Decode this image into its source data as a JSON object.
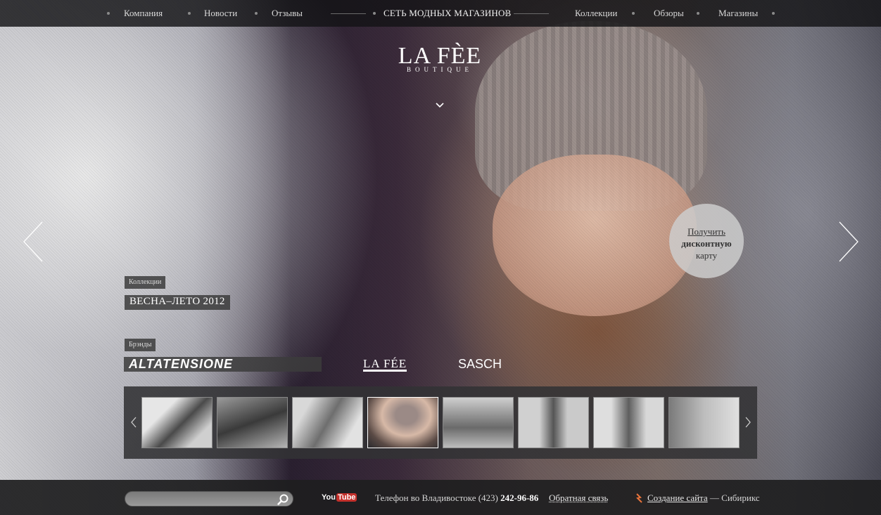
{
  "nav": {
    "left": [
      "Компания",
      "Новости",
      "Отзывы"
    ],
    "center": "СЕТЬ МОДНЫХ МАГАЗИНОВ",
    "right": [
      "Коллекции",
      "Обзоры",
      "Магазины"
    ]
  },
  "logo": {
    "wordmark": "LA FÈE",
    "sub": "BOUTIQUE"
  },
  "discount": {
    "line1": "Получить",
    "line2": "дисконтную",
    "line3": "карту"
  },
  "collection": {
    "tag": "Коллекции",
    "title": "ВЕСНА–ЛЕТО 2012"
  },
  "brands": {
    "tag": "Брэнды",
    "items": [
      "ALTATENSIONE",
      "LA FÉE",
      "SASCH"
    ]
  },
  "thumbnails": {
    "count": 8,
    "active_index": 3
  },
  "footer": {
    "search_placeholder": "",
    "youtube_you": "You",
    "youtube_tube": "Tube",
    "phone_label": "Телефон во Владивостоке (423)",
    "phone_number": "242-96-86",
    "feedback": "Обратная связь",
    "credit_link": "Создание сайта",
    "credit_rest": "— Сибирикс"
  }
}
